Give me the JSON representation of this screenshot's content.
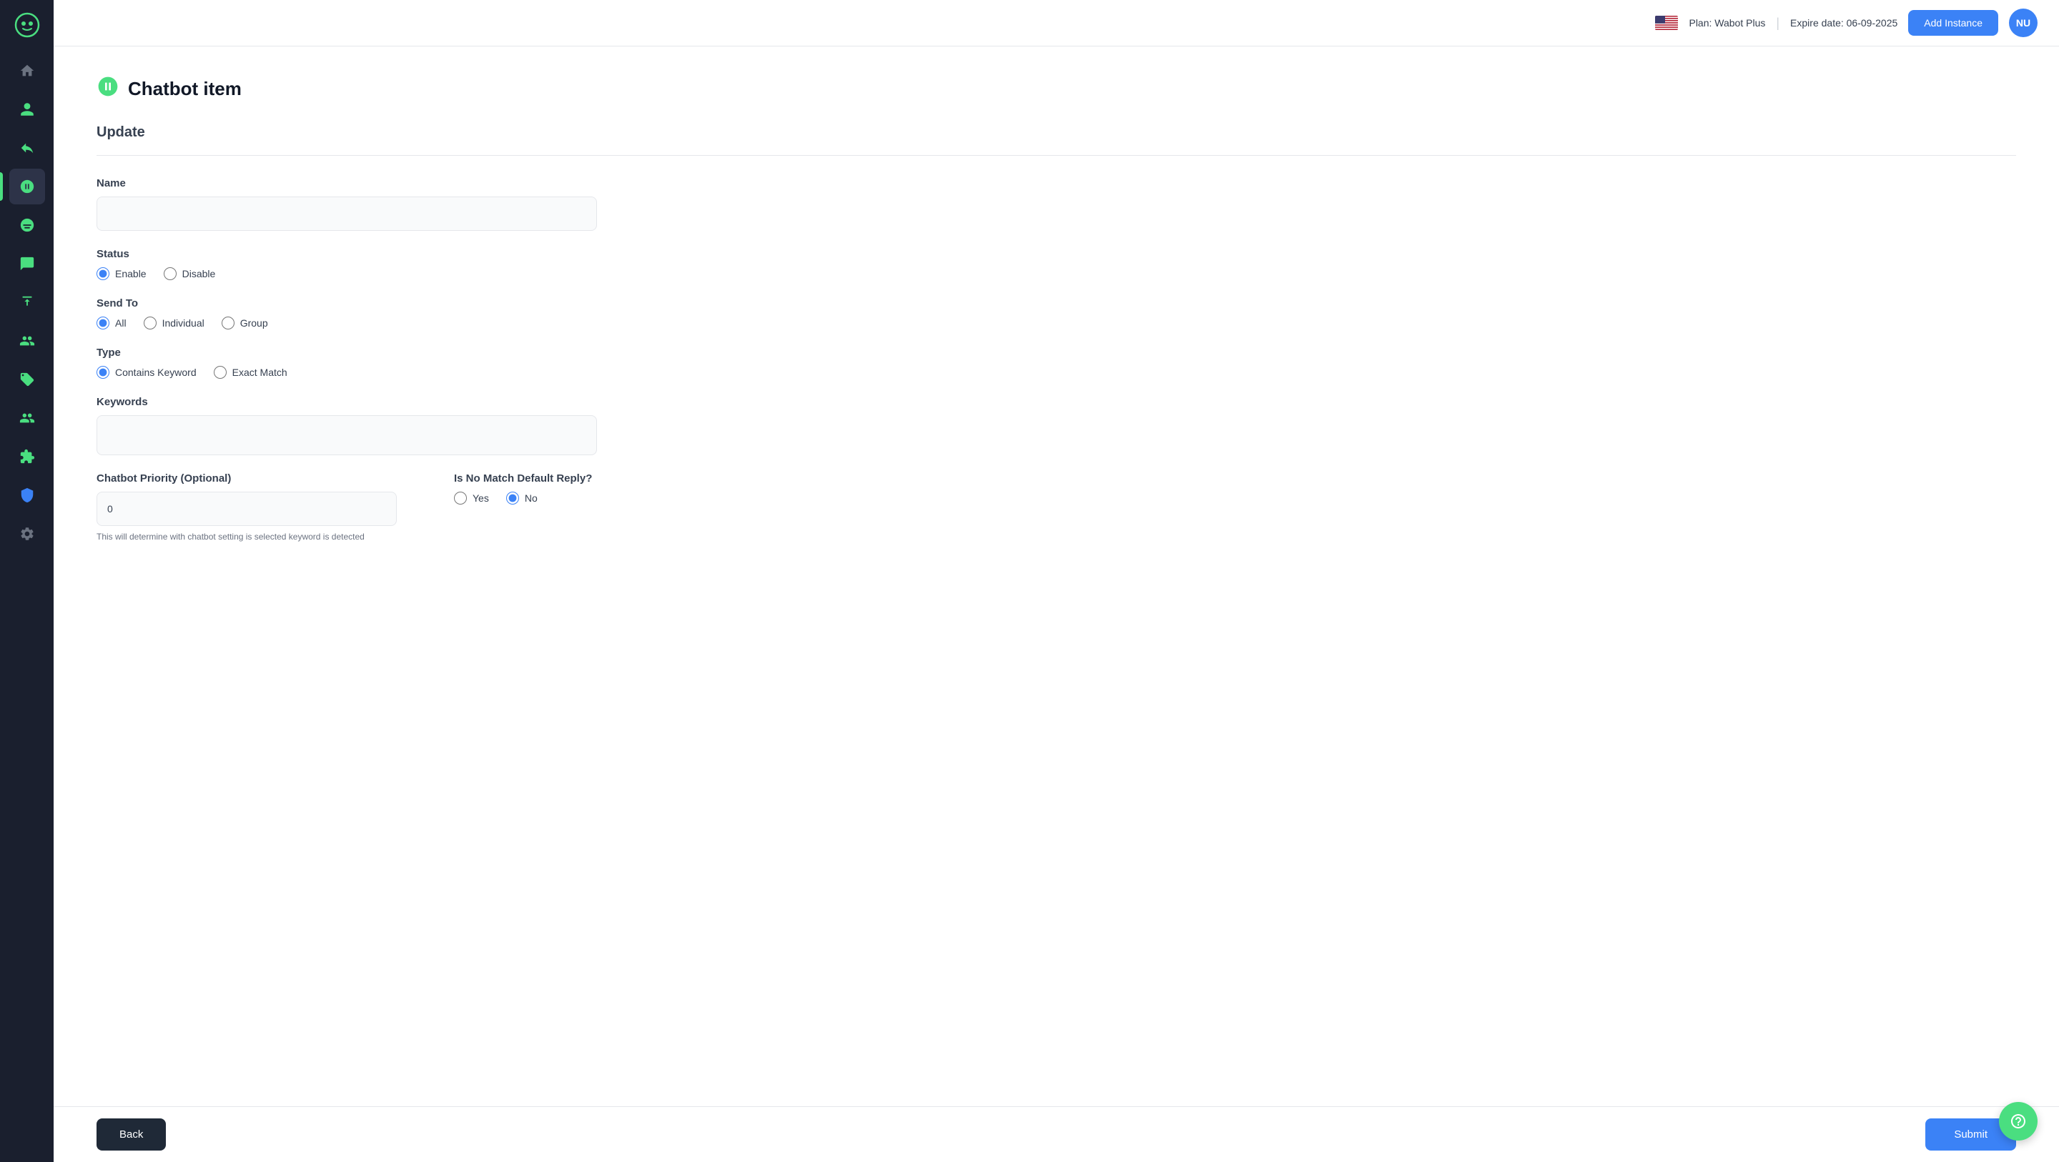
{
  "header": {
    "plan": "Plan: Wabot Plus",
    "divider": "|",
    "expire": "Expire date: 06-09-2025",
    "add_instance_label": "Add Instance",
    "avatar_initials": "NU"
  },
  "sidebar": {
    "items": [
      {
        "name": "home",
        "icon": "🏠",
        "active": false
      },
      {
        "name": "contacts",
        "icon": "👤",
        "active": false
      },
      {
        "name": "replies",
        "icon": "↩️",
        "active": false
      },
      {
        "name": "chatbot",
        "icon": "🤖",
        "active": true
      },
      {
        "name": "broadcast",
        "icon": "📢",
        "active": false
      },
      {
        "name": "chat",
        "icon": "💬",
        "active": false
      },
      {
        "name": "export",
        "icon": "📤",
        "active": false
      },
      {
        "name": "team",
        "icon": "👥",
        "active": false
      },
      {
        "name": "tags",
        "icon": "🏷️",
        "active": false
      },
      {
        "name": "groups",
        "icon": "👫",
        "active": false
      },
      {
        "name": "plugins",
        "icon": "🔌",
        "active": false
      },
      {
        "name": "shield",
        "icon": "💙",
        "active": false
      },
      {
        "name": "workflow",
        "icon": "⚙️",
        "active": false
      },
      {
        "name": "settings",
        "icon": "⚙️",
        "active": false
      }
    ]
  },
  "page": {
    "icon": "🤖",
    "title": "Chatbot item",
    "section": "Update"
  },
  "form": {
    "name_label": "Name",
    "name_placeholder": "",
    "status_label": "Status",
    "status_options": [
      {
        "value": "enable",
        "label": "Enable",
        "checked": true
      },
      {
        "value": "disable",
        "label": "Disable",
        "checked": false
      }
    ],
    "send_to_label": "Send To",
    "send_to_options": [
      {
        "value": "all",
        "label": "All",
        "checked": true
      },
      {
        "value": "individual",
        "label": "Individual",
        "checked": false
      },
      {
        "value": "group",
        "label": "Group",
        "checked": false
      }
    ],
    "type_label": "Type",
    "type_options": [
      {
        "value": "contains",
        "label": "Contains Keyword",
        "checked": true
      },
      {
        "value": "exact",
        "label": "Exact Match",
        "checked": false
      }
    ],
    "keywords_label": "Keywords",
    "keywords_placeholder": "",
    "priority_label": "Chatbot Priority (Optional)",
    "priority_value": "0",
    "priority_hint": "This will determine with chatbot setting is selected keyword is detected",
    "no_match_label": "Is No Match Default Reply?",
    "no_match_options": [
      {
        "value": "yes",
        "label": "Yes",
        "checked": false
      },
      {
        "value": "no",
        "label": "No",
        "checked": true
      }
    ]
  },
  "buttons": {
    "back": "Back",
    "submit": "Submit"
  }
}
